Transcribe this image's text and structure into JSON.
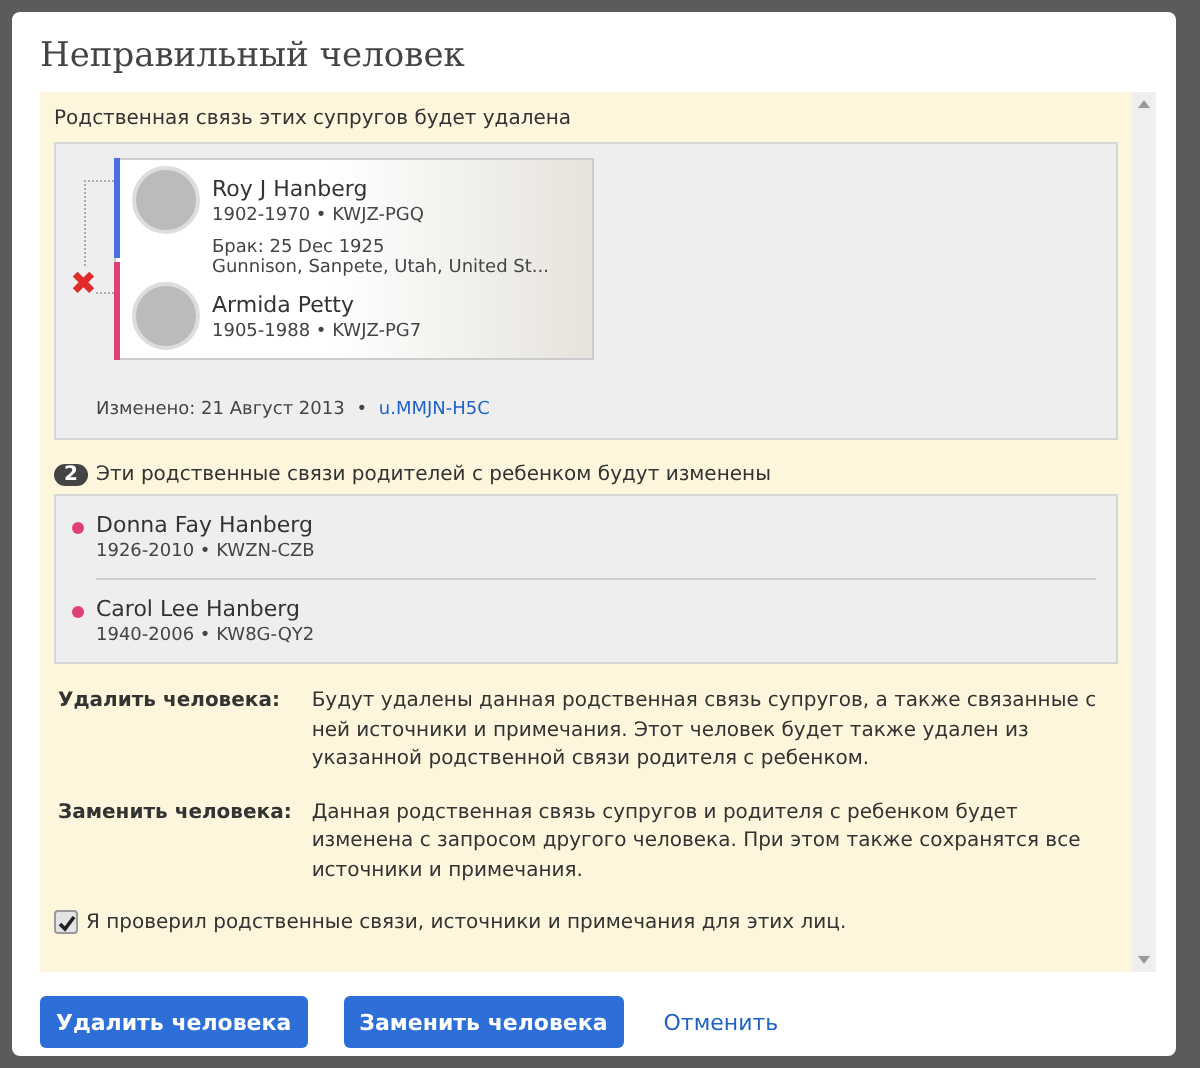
{
  "dialog": {
    "title": "Неправильный человек"
  },
  "couple_section": {
    "heading": "Родственная связь этих супругов будет удалена",
    "husband": {
      "name": "Roy J Hanberg",
      "details": "1902-1970 • KWJZ-PGQ",
      "color": "#4a6fe3"
    },
    "marriage": {
      "event": "Брак: 25 Dec 1925",
      "place": "Gunnison, Sanpete, Utah, United St..."
    },
    "wife": {
      "name": "Armida Petty",
      "details": "1905-1988 • KWJZ-PG7",
      "color": "#e0407a"
    },
    "removed_mark": "✖",
    "changed": "Изменено: 21 Август 2013",
    "separator": "•",
    "changed_by": "u.MMJN-H5C"
  },
  "children_section": {
    "count": "2",
    "heading": "Эти родственные связи родителей с ребенком будут изменены",
    "children": [
      {
        "name": "Donna Fay Hanberg",
        "details": "1926-2010 • KWZN-CZB",
        "color": "#e0407a"
      },
      {
        "name": "Carol Lee Hanberg",
        "details": "1940-2006 • KW8G-QY2",
        "color": "#e0407a"
      }
    ]
  },
  "explanations": [
    {
      "term": "Удалить человека:",
      "text": "Будут удалены данная родственная связь супругов, а также связанные с ней источники и примечания. Этот человек будет также удален из указанной родственной связи родителя с ребенком."
    },
    {
      "term": "Заменить человека:",
      "text": "Данная родственная связь супругов и родителя с ребенком будет изменена с запросом другого человека. При этом также сохранятся все источники и примечания."
    }
  ],
  "confirm": {
    "label": "Я проверил родственные связи, источники и примечания для этих лиц.",
    "checked": true
  },
  "buttons": [
    {
      "label": "Удалить человека",
      "kind": "primary"
    },
    {
      "label": "Заменить человека",
      "kind": "primary"
    },
    {
      "label": "Отменить",
      "kind": "link"
    }
  ]
}
